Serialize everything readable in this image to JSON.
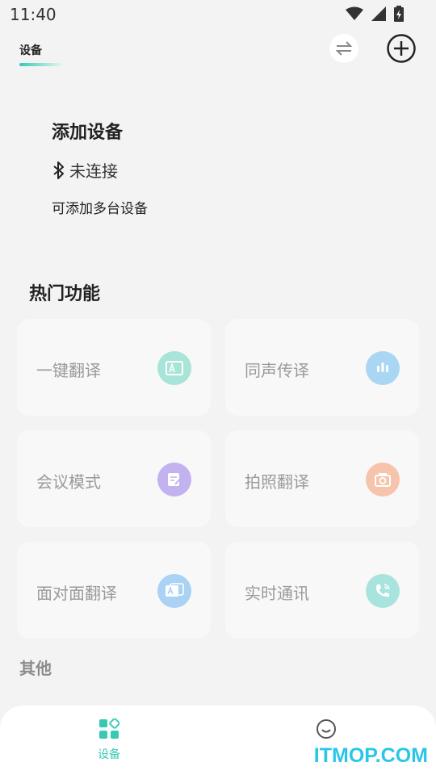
{
  "status_bar": {
    "time": "11:40"
  },
  "header": {
    "tab_label": "设备",
    "switch_icon": "swap-arrows-icon",
    "add_icon": "plus-circle-icon"
  },
  "device_card": {
    "title": "添加设备",
    "bluetooth_icon": "bluetooth-icon",
    "status": "未连接",
    "hint": "可添加多台设备"
  },
  "hot_features": {
    "title": "热门功能",
    "items": [
      {
        "label": "一键翻译",
        "icon": "translate-icon",
        "color": "#a8e4d8"
      },
      {
        "label": "同声传译",
        "icon": "audio-wave-icon",
        "color": "#a9d6f2"
      },
      {
        "label": "会议模式",
        "icon": "notes-icon",
        "color": "#c2b2f0"
      },
      {
        "label": "拍照翻译",
        "icon": "camera-icon",
        "color": "#f6c3ab"
      },
      {
        "label": "面对面翻译",
        "icon": "face-to-face-icon",
        "color": "#a9d2f4"
      },
      {
        "label": "实时通讯",
        "icon": "phone-call-icon",
        "color": "#a9e3de"
      }
    ]
  },
  "other": {
    "title": "其他"
  },
  "bottom_nav": {
    "items": [
      {
        "label": "设备",
        "icon": "grid-icon",
        "active": true,
        "color": "#37c9b4"
      },
      {
        "label": "",
        "icon": "smile-icon",
        "active": false,
        "color": "#555555"
      }
    ]
  },
  "watermark": "ITMOP.COM"
}
